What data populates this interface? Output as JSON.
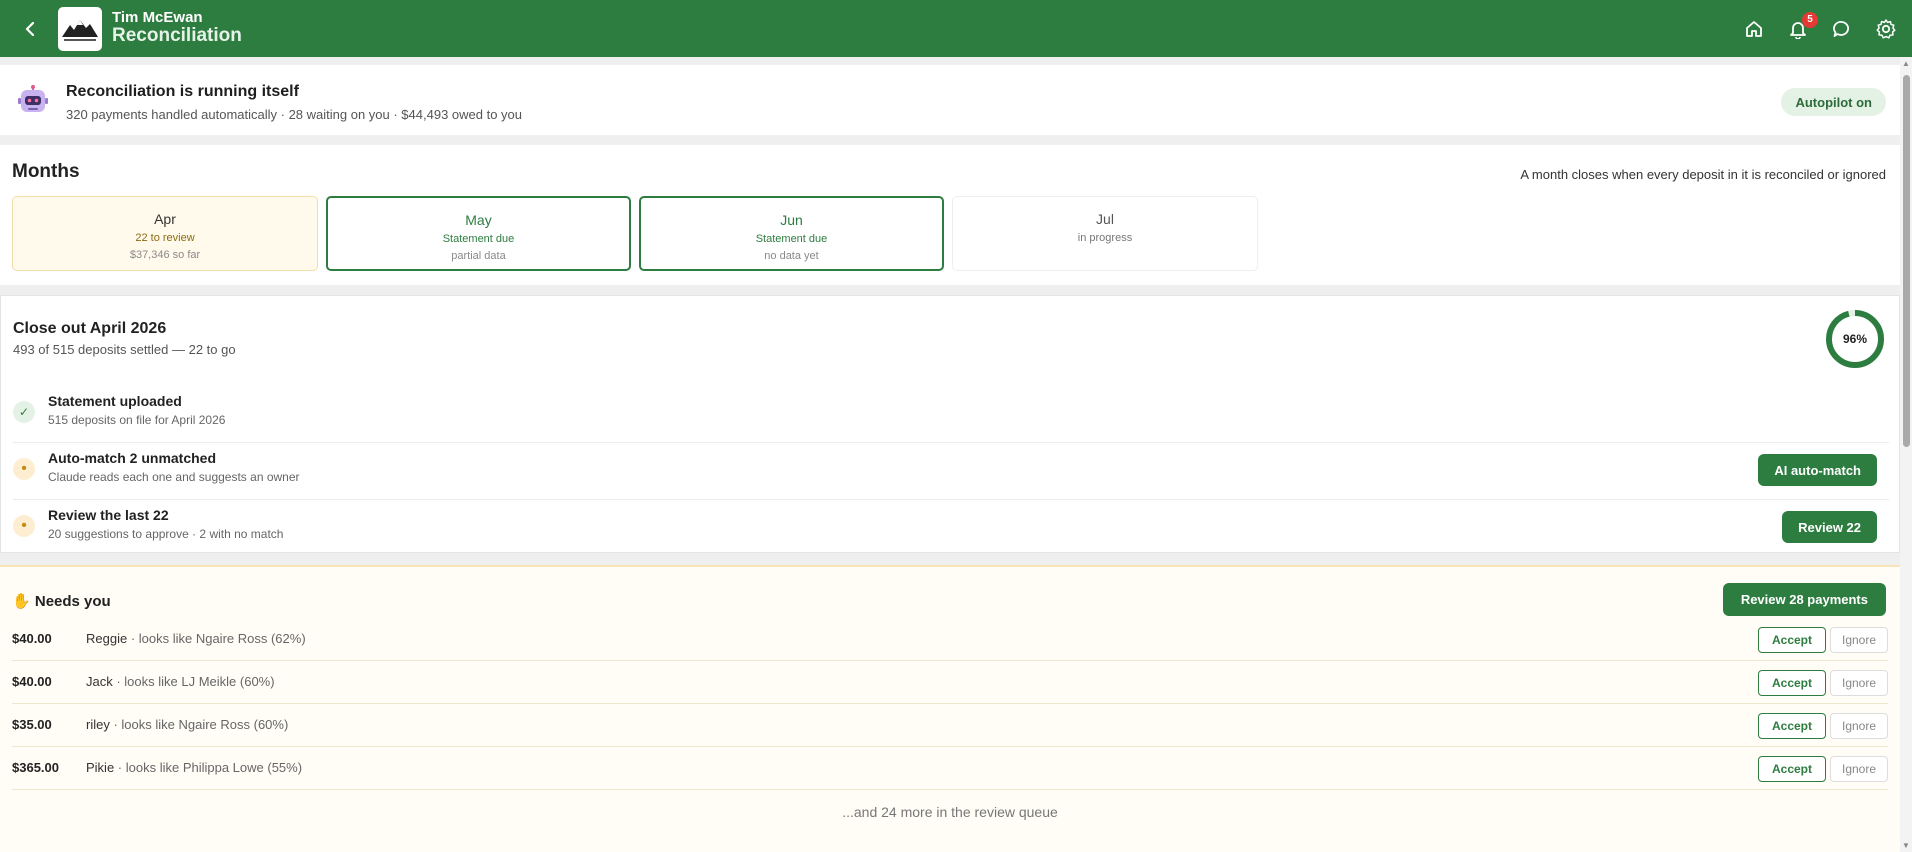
{
  "header": {
    "user_name": "Tim McEwan",
    "page_title": "Reconciliation",
    "notification_count": "5",
    "icons": [
      "back-icon",
      "home-icon",
      "bell-icon",
      "chat-icon",
      "gear-icon"
    ]
  },
  "autopilot": {
    "title": "Reconciliation is running itself",
    "subtitle": "320 payments handled automatically · 28 waiting on you · $44,493 owed to you",
    "pill": "Autopilot on"
  },
  "months": {
    "title": "Months",
    "note": "A month closes when every deposit in it is reconciled or ignored",
    "items": [
      {
        "name": "Apr",
        "status": "22 to review",
        "extra": "$37,346 so far"
      },
      {
        "name": "May",
        "status": "Statement due",
        "extra": "partial data"
      },
      {
        "name": "Jun",
        "status": "Statement due",
        "extra": "no data yet"
      },
      {
        "name": "Jul",
        "status": "in progress",
        "extra": ""
      }
    ]
  },
  "close_out": {
    "title": "Close out April 2026",
    "subtitle": "493 of 515 deposits settled — 22 to go",
    "progress_label": "96%",
    "progress_value": 0.96,
    "steps": [
      {
        "title": "Statement uploaded",
        "sub": "515 deposits on file for April 2026",
        "status": "done",
        "glyph": "✓"
      },
      {
        "title": "Auto-match 2 unmatched",
        "sub": "Claude reads each one and suggests an owner",
        "status": "pending",
        "glyph": "•",
        "button": "AI auto-match"
      },
      {
        "title": "Review the last 22",
        "sub": "20 suggestions to approve · 2 with no match",
        "status": "pending",
        "glyph": "•",
        "button": "Review 22"
      }
    ]
  },
  "needs_you": {
    "emoji": "✋",
    "title": "Needs you",
    "button": "Review 28 payments",
    "accept_label": "Accept",
    "ignore_label": "Ignore",
    "payments": [
      {
        "amount": "$40.00",
        "name": "Reggie",
        "hint": " · looks like Ngaire Ross (62%)"
      },
      {
        "amount": "$40.00",
        "name": "Jack",
        "hint": " · looks like LJ Meikle (60%)"
      },
      {
        "amount": "$35.00",
        "name": "riley",
        "hint": " · looks like Ngaire Ross (60%)"
      },
      {
        "amount": "$365.00",
        "name": "Pikie",
        "hint": " · looks like Philippa Lowe (55%)"
      }
    ],
    "more": "...and 24 more in the review queue"
  },
  "colors": {
    "brand_green": "#2e7d40",
    "pending_amber": "#c68a12",
    "notification_red": "#e53935"
  }
}
